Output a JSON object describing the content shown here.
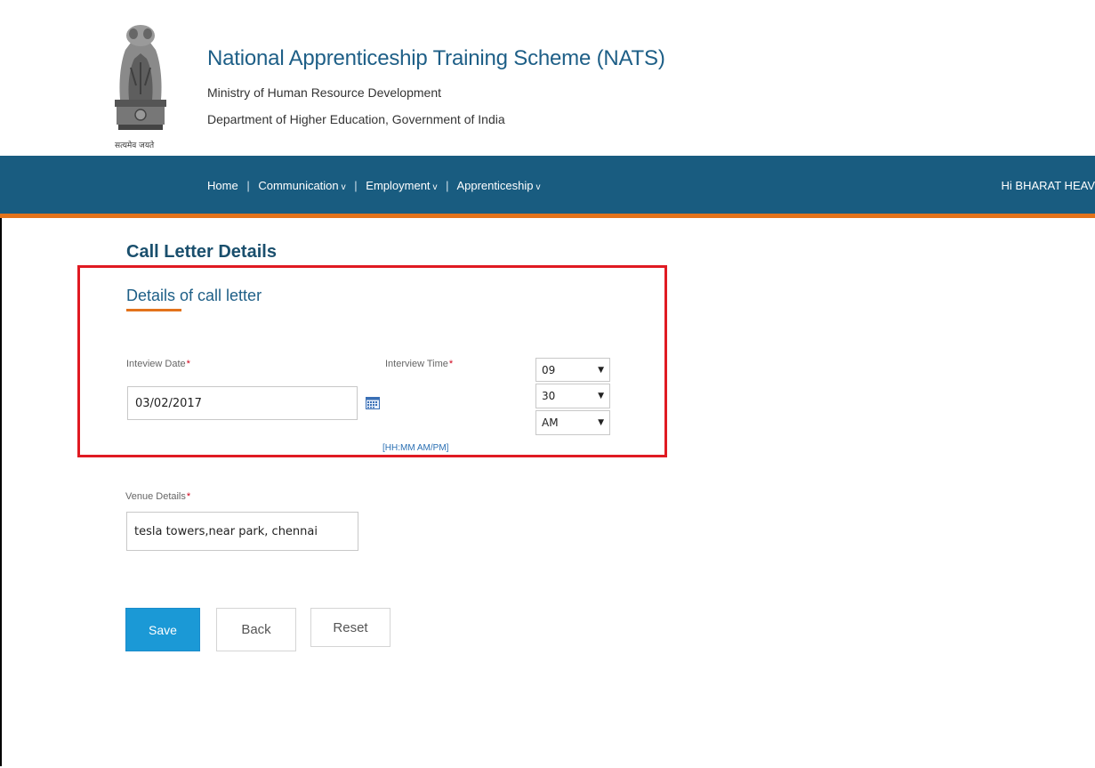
{
  "header": {
    "title": "National Apprenticeship Training Scheme (NATS)",
    "ministry": "Ministry of Human Resource Development",
    "department": "Department of Higher Education, Government of India",
    "emblem_caption": "सत्यमेव जयते"
  },
  "nav": {
    "items": [
      {
        "label": "Home",
        "has_dropdown": false
      },
      {
        "label": "Communication",
        "has_dropdown": true
      },
      {
        "label": "Employment",
        "has_dropdown": true
      },
      {
        "label": "Apprenticeship",
        "has_dropdown": true
      }
    ],
    "dropdown_glyph": "v",
    "separator": "|",
    "greeting": "Hi BHARAT HEAV"
  },
  "page": {
    "title": "Call Letter Details",
    "section_title": "Details of call letter"
  },
  "form": {
    "interview_date": {
      "label": "Inteview Date",
      "required_mark": "*",
      "value": "03/02/2017",
      "icon": "calendar-icon"
    },
    "interview_time": {
      "label": "Interview Time",
      "required_mark": "*",
      "hour": "09",
      "minute": "30",
      "meridiem": "AM",
      "hint": "[HH:MM AM/PM]"
    },
    "venue": {
      "label": "Venue Details",
      "required_mark": "*",
      "value": "tesla towers,near park, chennai"
    }
  },
  "buttons": {
    "save": "Save",
    "back": "Back",
    "reset": "Reset"
  },
  "colors": {
    "nav_bg": "#195c80",
    "accent_orange": "#e3731b",
    "title_blue": "#1e5f87",
    "highlight_red": "#e01a22",
    "primary_button": "#1b99d6",
    "required_red": "#d0021b"
  }
}
